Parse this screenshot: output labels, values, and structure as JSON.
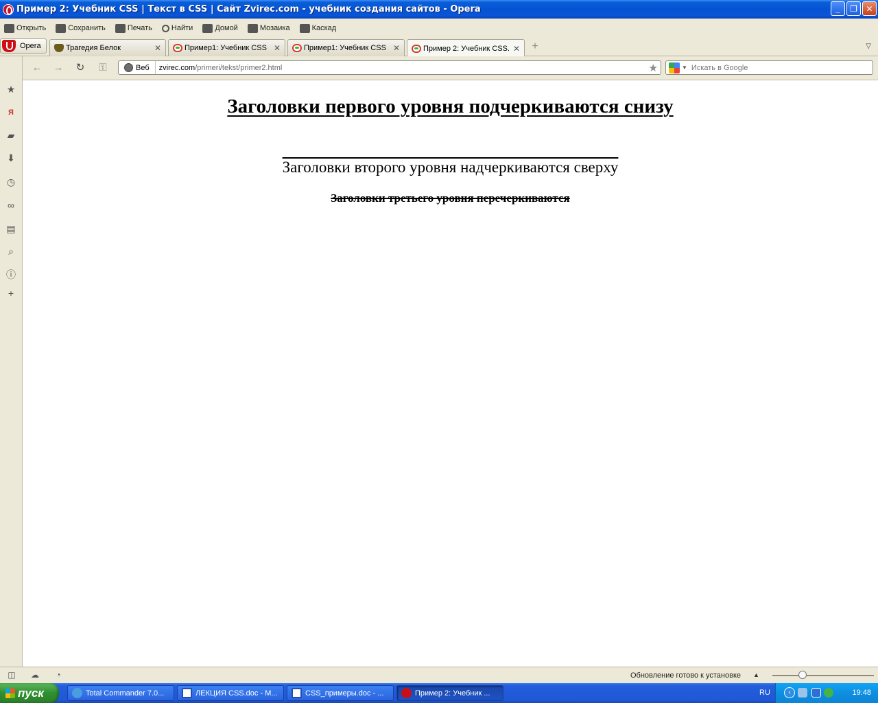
{
  "window": {
    "title": "Пример 2: Учебник CSS | Текст в CSS | Сайт Zvirec.com - учебник создания сайтов - Opera"
  },
  "menu": [
    {
      "label": "Открыть",
      "icon": "folder-icon"
    },
    {
      "label": "Сохранить",
      "icon": "save-icon"
    },
    {
      "label": "Печать",
      "icon": "print-icon"
    },
    {
      "label": "Найти",
      "icon": "find-icon"
    },
    {
      "label": "Домой",
      "icon": "home-icon"
    },
    {
      "label": "Мозаика",
      "icon": "tile-icon"
    },
    {
      "label": "Каскад",
      "icon": "cascade-icon"
    }
  ],
  "tabs": {
    "opera_label": "Opera",
    "items": [
      {
        "label": "Трагедия Белок",
        "active": false
      },
      {
        "label": "Пример1: Учебник CSS ...",
        "active": false
      },
      {
        "label": "Пример1: Учебник CSS ...",
        "active": false
      },
      {
        "label": "Пример 2: Учебник CSS...",
        "active": true
      }
    ]
  },
  "address": {
    "web_label": "Веб",
    "host": "zvirec.com",
    "path": "/primeri/tekst/primer2.html"
  },
  "search": {
    "placeholder": "Искать в Google"
  },
  "page": {
    "h1": "Заголовки первого уровня подчеркиваются снизу",
    "h2": "Заголовки второго уровня надчеркиваются сверху",
    "h3": "Заголовки третьего уровня перечеркиваются"
  },
  "status": {
    "update_text": "Обновление готово к установке",
    "zoom_fraction": 0.28
  },
  "taskbar": {
    "start_label": "пуск",
    "tasks": [
      {
        "label": "Total Commander 7.0...",
        "active": false
      },
      {
        "label": "ЛЕКЦИЯ CSS.doc - M...",
        "active": false
      },
      {
        "label": "CSS_примеры.doc - ...",
        "active": false
      },
      {
        "label": "Пример 2: Учебник ...",
        "active": true
      }
    ],
    "lang": "RU",
    "time": "19:48"
  },
  "colors": {
    "xp_blue": "#0553d4",
    "start_green": "#2f8f2f",
    "opera_red": "#cc0f16"
  }
}
